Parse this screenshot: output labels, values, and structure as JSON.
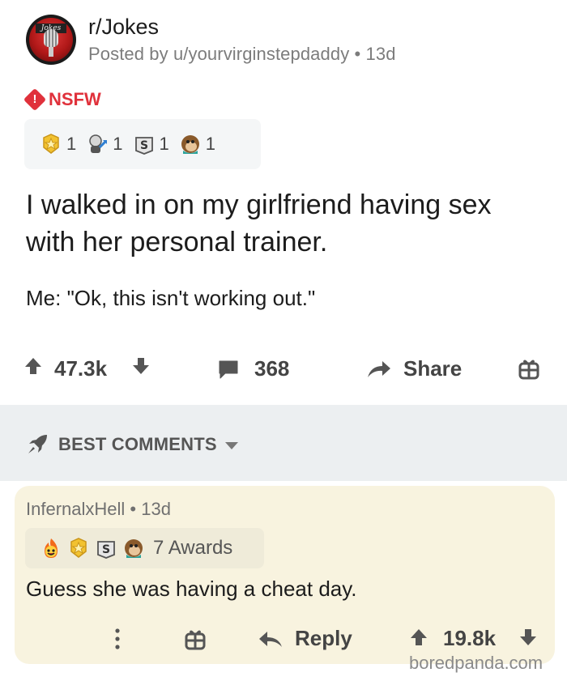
{
  "post": {
    "subreddit": "r/Jokes",
    "avatar_text": "Jokes",
    "posted_by": "Posted by u/yourvirginstepdaddy",
    "age": "13d",
    "nsfw_label": "NSFW",
    "awards": [
      {
        "icon": "gold-award-icon",
        "count": "1"
      },
      {
        "icon": "helpful-award-icon",
        "count": "1"
      },
      {
        "icon": "silver-award-icon",
        "count": "1"
      },
      {
        "icon": "monkey-award-icon",
        "count": "1"
      }
    ],
    "title": "I walked in on my girlfriend having sex with her personal trainer.",
    "body": "Me: \"Ok, this isn't working out.\"",
    "votes": "47.3k",
    "comments": "368",
    "share_label": "Share"
  },
  "sort": {
    "label": "BEST COMMENTS"
  },
  "comment": {
    "author": "InfernalxHell",
    "age": "13d",
    "awards_label": "7 Awards",
    "text": "Guess she was having a cheat day.",
    "reply_label": "Reply",
    "votes": "19.8k"
  },
  "watermark": "boredpanda.com",
  "colors": {
    "nsfw": "#e0313b",
    "comment_bg": "#f8f3df",
    "sort_bar_bg": "#eceff1"
  }
}
